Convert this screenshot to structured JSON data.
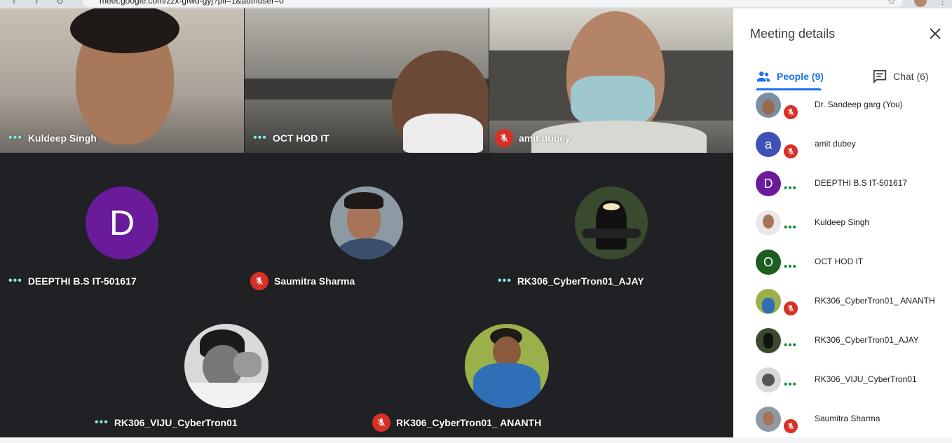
{
  "browser": {
    "url": "meet.google.com/zzx-gfwd-gyj?pli=1&authuser=0"
  },
  "tiles": {
    "t1": {
      "name": "Kuldeep Singh"
    },
    "t2": {
      "name": "OCT HOD IT"
    },
    "t3": {
      "name": "amit dubey"
    },
    "t4": {
      "name": "DEEPTHI B.S IT-501617",
      "initial": "D"
    },
    "t5": {
      "name": "Saumitra Sharma"
    },
    "t6": {
      "name": "RK306_CyberTron01_AJAY"
    },
    "t7": {
      "name": "RK306_VIJU_CyberTron01"
    },
    "t8": {
      "name": "RK306_CyberTron01_ ANANTH"
    }
  },
  "panel": {
    "title": "Meeting details",
    "tabs": {
      "people": "People (9)",
      "chat": "Chat (6)"
    },
    "people": [
      {
        "name": "Dr. Sandeep garg (You)"
      },
      {
        "name": "amit dubey",
        "initial": "a"
      },
      {
        "name": "DEEPTHI B.S IT-501617",
        "initial": "D"
      },
      {
        "name": "Kuldeep Singh"
      },
      {
        "name": "OCT HOD IT",
        "initial": "O"
      },
      {
        "name": "RK306_CyberTron01_ ANANTH"
      },
      {
        "name": "RK306_CyberTron01_AJAY"
      },
      {
        "name": "RK306_VIJU_CyberTron01"
      },
      {
        "name": "Saumitra Sharma"
      }
    ]
  },
  "colors": {
    "accent": "#1a73e8",
    "mute_red": "#d93025",
    "avatar_purple": "#6a1b9a",
    "avatar_blue": "#3f51b5",
    "avatar_green": "#1b5e20",
    "speaking_teal": "#81e6d9"
  }
}
